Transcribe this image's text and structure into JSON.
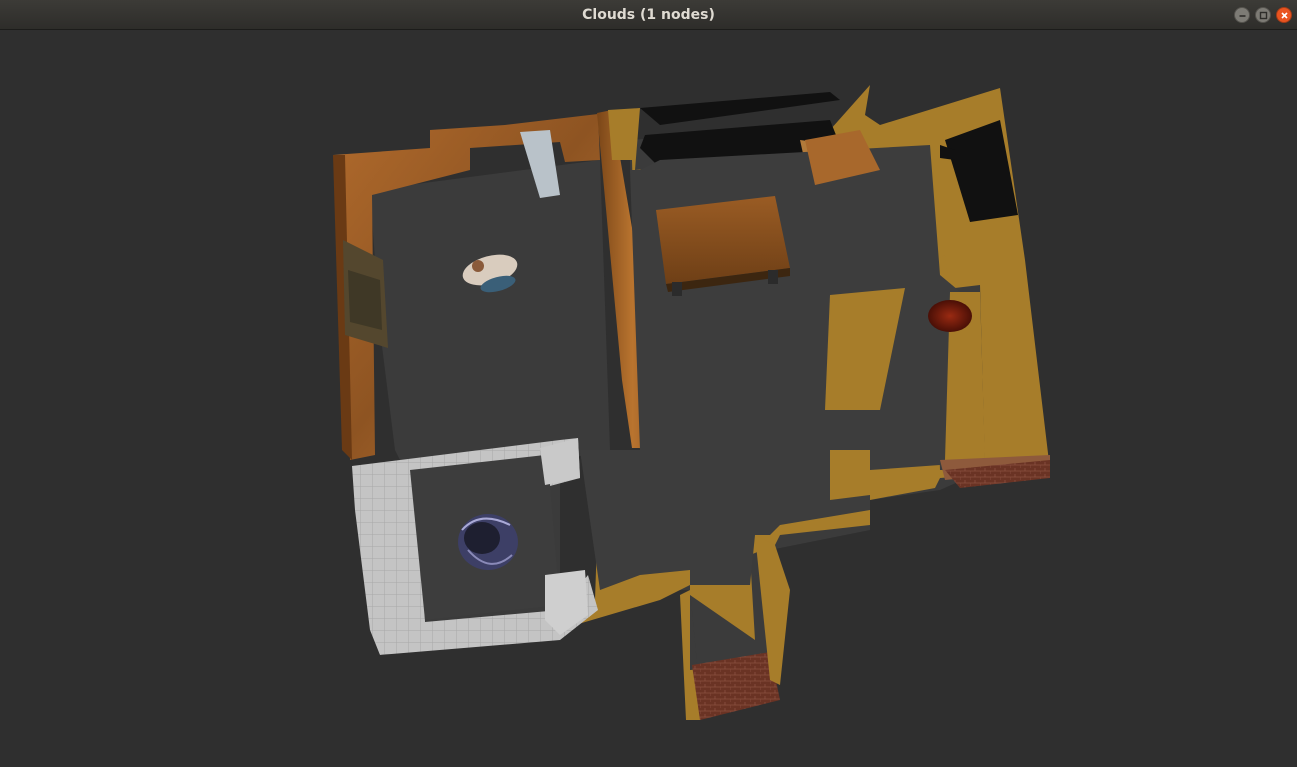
{
  "window": {
    "title": "Clouds (1 nodes)",
    "buttons": [
      "minimize",
      "maximize",
      "close"
    ]
  },
  "viewport": {
    "background": "#2f2f2f",
    "content": "point-cloud-map"
  },
  "colors": {
    "floor": "#3b3b3b",
    "wood_wall": "#a0602a",
    "yellow_wall": "#a77d2a",
    "white_wall": "#c8c8c8",
    "close_button": "#e95420"
  }
}
